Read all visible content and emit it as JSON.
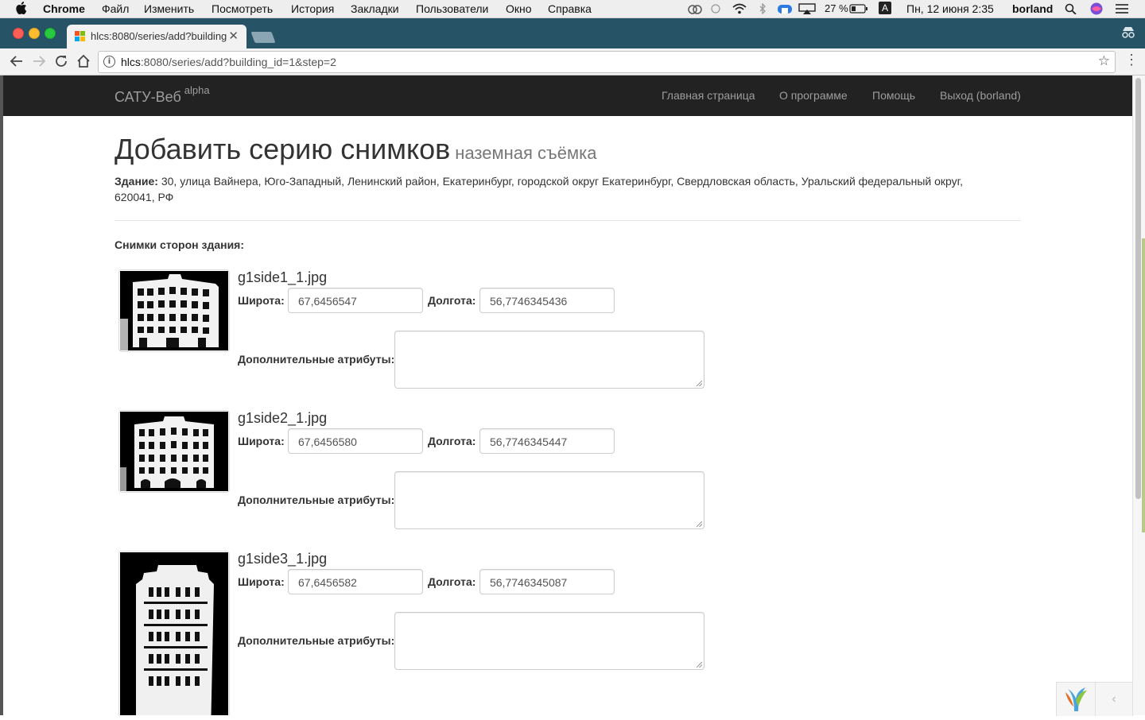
{
  "menubar": {
    "app_name": "Chrome",
    "items": [
      "Файл",
      "Изменить",
      "Посмотреть",
      "История",
      "Закладки",
      "Пользователи",
      "Окно",
      "Справка"
    ],
    "battery": "27 %",
    "input_source": "A",
    "datetime": "Пн, 12 июня  2:35",
    "user": "borland"
  },
  "browser": {
    "tab_title": "hlcs:8080/series/add?building",
    "url_host": "hlcs",
    "url_path": ":8080/series/add?building_id=1&step=2"
  },
  "navbar": {
    "brand": "САТУ-Веб",
    "brand_tag": "alpha",
    "links": [
      "Главная страница",
      "О программе",
      "Помощь",
      "Выход (borland)"
    ]
  },
  "page": {
    "title": "Добавить серию снимков",
    "subtitle": "наземная съёмка",
    "building_label": "Здание:",
    "building_address": "30, улица Вайнера, Юго-Западный, Ленинский район, Екатеринбург, городской округ Екатеринбург, Свердловская область, Уральский федеральный округ, 620041, РФ",
    "section_label": "Снимки сторон здания:",
    "lat_label": "Широта:",
    "lon_label": "Долгота:",
    "attrs_label": "Дополнительные атрибуты:",
    "photos": [
      {
        "filename": "g1side1_1.jpg",
        "lat": "67,6456547",
        "lon": "56,7746345436",
        "attrs": ""
      },
      {
        "filename": "g1side2_1.jpg",
        "lat": "67,6456580",
        "lon": "56,7746345447",
        "attrs": ""
      },
      {
        "filename": "g1side3_1.jpg",
        "lat": "67,6456582",
        "lon": "56,7746345087",
        "attrs": ""
      }
    ]
  },
  "colors": {
    "navbar_bg": "#222222",
    "navbar_text": "#9d9d9d",
    "tabstrip_bg": "#275366"
  },
  "icons": {
    "debug_logo": "yii-logo-icon",
    "debug_toggle": "chevron-left-icon"
  }
}
